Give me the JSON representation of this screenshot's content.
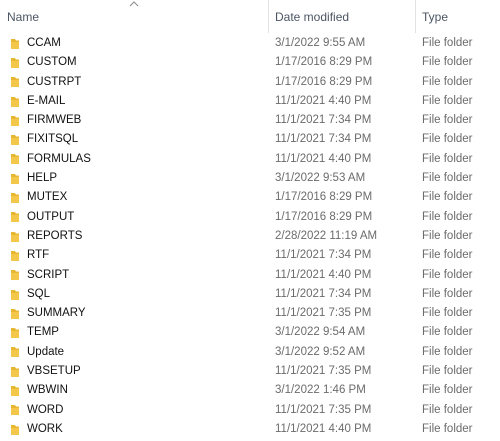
{
  "columns": {
    "name": "Name",
    "date_modified": "Date modified",
    "type": "Type"
  },
  "sort": {
    "column": "name",
    "direction": "ascending",
    "indicator_icon": "sort-up-icon"
  },
  "folder_color": "#e8b732",
  "rows": [
    {
      "name": "CCAM",
      "date": "3/1/2022 9:55 AM",
      "type": "File folder"
    },
    {
      "name": "CUSTOM",
      "date": "1/17/2016 8:29 PM",
      "type": "File folder"
    },
    {
      "name": "CUSTRPT",
      "date": "1/17/2016 8:29 PM",
      "type": "File folder"
    },
    {
      "name": "E-MAIL",
      "date": "11/1/2021 4:40 PM",
      "type": "File folder"
    },
    {
      "name": "FIRMWEB",
      "date": "11/1/2021 7:34 PM",
      "type": "File folder"
    },
    {
      "name": "FIXITSQL",
      "date": "11/1/2021 7:34 PM",
      "type": "File folder"
    },
    {
      "name": "FORMULAS",
      "date": "11/1/2021 4:40 PM",
      "type": "File folder"
    },
    {
      "name": "HELP",
      "date": "3/1/2022 9:53 AM",
      "type": "File folder"
    },
    {
      "name": "MUTEX",
      "date": "1/17/2016 8:29 PM",
      "type": "File folder"
    },
    {
      "name": "OUTPUT",
      "date": "1/17/2016 8:29 PM",
      "type": "File folder"
    },
    {
      "name": "REPORTS",
      "date": "2/28/2022 11:19 AM",
      "type": "File folder"
    },
    {
      "name": "RTF",
      "date": "11/1/2021 7:34 PM",
      "type": "File folder"
    },
    {
      "name": "SCRIPT",
      "date": "11/1/2021 4:40 PM",
      "type": "File folder"
    },
    {
      "name": "SQL",
      "date": "11/1/2021 7:34 PM",
      "type": "File folder"
    },
    {
      "name": "SUMMARY",
      "date": "11/1/2021 7:35 PM",
      "type": "File folder"
    },
    {
      "name": "TEMP",
      "date": "3/1/2022 9:54 AM",
      "type": "File folder"
    },
    {
      "name": "Update",
      "date": "3/1/2022 9:52 AM",
      "type": "File folder"
    },
    {
      "name": "VBSETUP",
      "date": "11/1/2021 7:35 PM",
      "type": "File folder"
    },
    {
      "name": "WBWIN",
      "date": "3/1/2022 1:46 PM",
      "type": "File folder"
    },
    {
      "name": "WORD",
      "date": "11/1/2021 7:35 PM",
      "type": "File folder"
    },
    {
      "name": "WORK",
      "date": "11/1/2021 4:40 PM",
      "type": "File folder"
    }
  ]
}
